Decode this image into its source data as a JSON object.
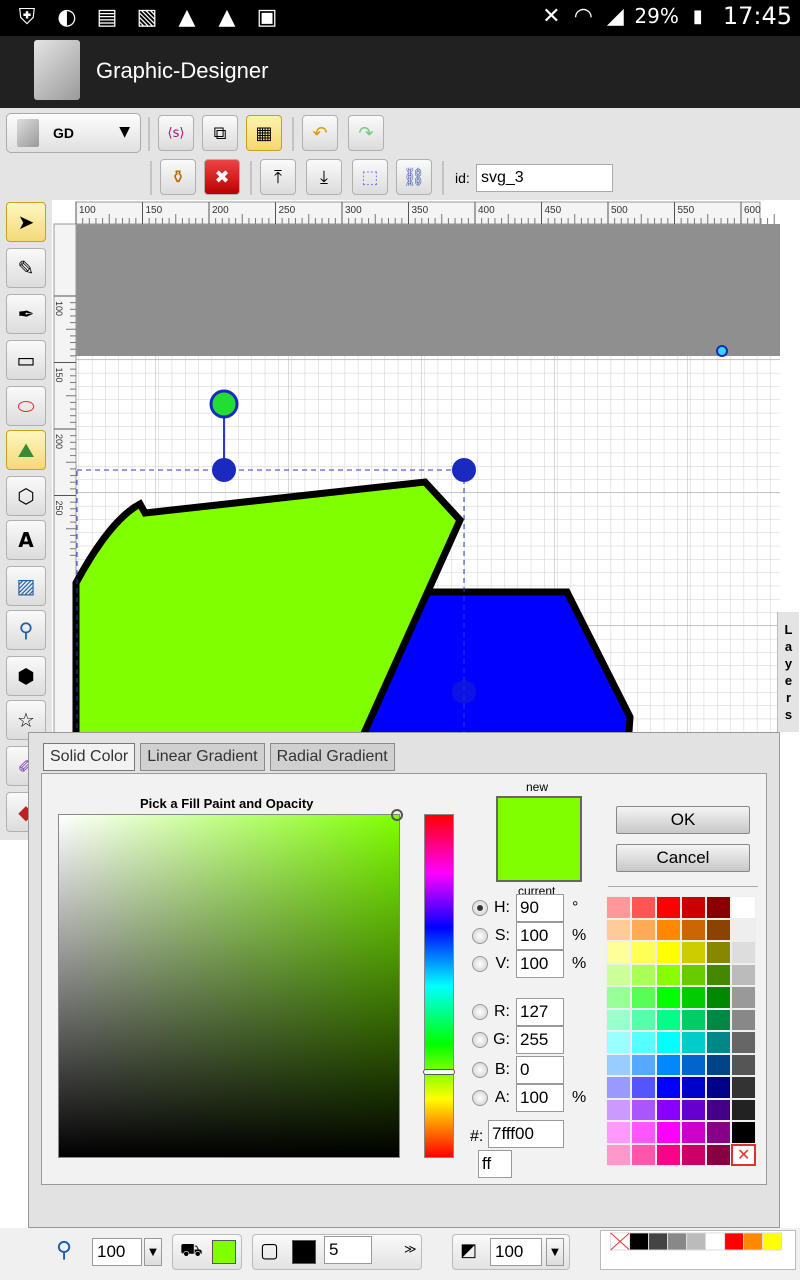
{
  "status_bar": {
    "battery": "29%",
    "time": "17:45",
    "icons": [
      "shield-icon",
      "mask-icon",
      "sim-icon",
      "image-icon",
      "alert-icon",
      "alert-icon",
      "briefcase-icon"
    ]
  },
  "app": {
    "title": "Graphic-Designer"
  },
  "toolbar": {
    "context_label": "GD",
    "id_label": "id:",
    "id_value": "svg_3"
  },
  "ruler": {
    "ticks": [
      "100",
      "150",
      "200",
      "250",
      "300",
      "350",
      "400",
      "450",
      "500",
      "550",
      "600"
    ],
    "vticks": [
      "100",
      "150",
      "200",
      "250"
    ]
  },
  "layers_label": [
    "L",
    "a",
    "y",
    "e",
    "r",
    "s"
  ],
  "fill_dialog": {
    "tabs": [
      "Solid Color",
      "Linear Gradient",
      "Radial Gradient"
    ],
    "title": "Pick a Fill Paint and Opacity",
    "new_label": "new",
    "current_label": "current",
    "fields": [
      {
        "label": "H:",
        "value": "90",
        "unit": "°",
        "checked": true
      },
      {
        "label": "S:",
        "value": "100",
        "unit": "%",
        "checked": false
      },
      {
        "label": "V:",
        "value": "100",
        "unit": "%",
        "checked": false
      },
      {
        "label": "R:",
        "value": "127",
        "unit": "",
        "checked": false
      },
      {
        "label": "G:",
        "value": "255",
        "unit": "",
        "checked": false
      },
      {
        "label": "B:",
        "value": "0",
        "unit": "",
        "checked": false
      },
      {
        "label": "A:",
        "value": "100",
        "unit": "%",
        "checked": false
      }
    ],
    "hex_label": "#:",
    "hex_value": "7fff00",
    "alpha_hex": "ff",
    "ok_label": "OK",
    "cancel_label": "Cancel",
    "selected_color": "#7fff00"
  },
  "palette": [
    [
      "#ff9999",
      "#ff5555",
      "#ff0000",
      "#cc0000",
      "#880000",
      "#ffffff"
    ],
    [
      "#ffcc99",
      "#ffaa55",
      "#ff8800",
      "#cc6600",
      "#884400",
      "#eeeeee"
    ],
    [
      "#ffff99",
      "#ffff55",
      "#ffff00",
      "#cccc00",
      "#888800",
      "#dddddd"
    ],
    [
      "#ccff99",
      "#aaff55",
      "#88ff00",
      "#66cc00",
      "#448800",
      "#bbbbbb"
    ],
    [
      "#99ff99",
      "#55ff55",
      "#00ff00",
      "#00cc00",
      "#008800",
      "#999999"
    ],
    [
      "#99ffcc",
      "#55ffaa",
      "#00ff88",
      "#00cc66",
      "#008844",
      "#888888"
    ],
    [
      "#99ffff",
      "#55ffff",
      "#00ffff",
      "#00cccc",
      "#008888",
      "#666666"
    ],
    [
      "#99ccff",
      "#55aaff",
      "#0088ff",
      "#0066cc",
      "#004488",
      "#555555"
    ],
    [
      "#9999ff",
      "#5555ff",
      "#0000ff",
      "#0000cc",
      "#000088",
      "#333333"
    ],
    [
      "#cc99ff",
      "#aa55ff",
      "#8800ff",
      "#6600cc",
      "#440088",
      "#222222"
    ],
    [
      "#ff99ff",
      "#ff55ff",
      "#ff00ff",
      "#cc00cc",
      "#880088",
      "#000000"
    ],
    [
      "#ff99cc",
      "#ff55aa",
      "#ff0088",
      "#cc0066",
      "#880044",
      "none"
    ]
  ],
  "bottom_bar": {
    "zoom": "100",
    "fill_color": "#7fff00",
    "stroke_color": "#000000",
    "stroke_width": "5",
    "opacity": "100",
    "quick_palette": [
      "none",
      "#000000",
      "#444444",
      "#888888",
      "#bbbbbb",
      "#ffffff",
      "#ff0000",
      "#ff8800",
      "#ffff00"
    ]
  }
}
